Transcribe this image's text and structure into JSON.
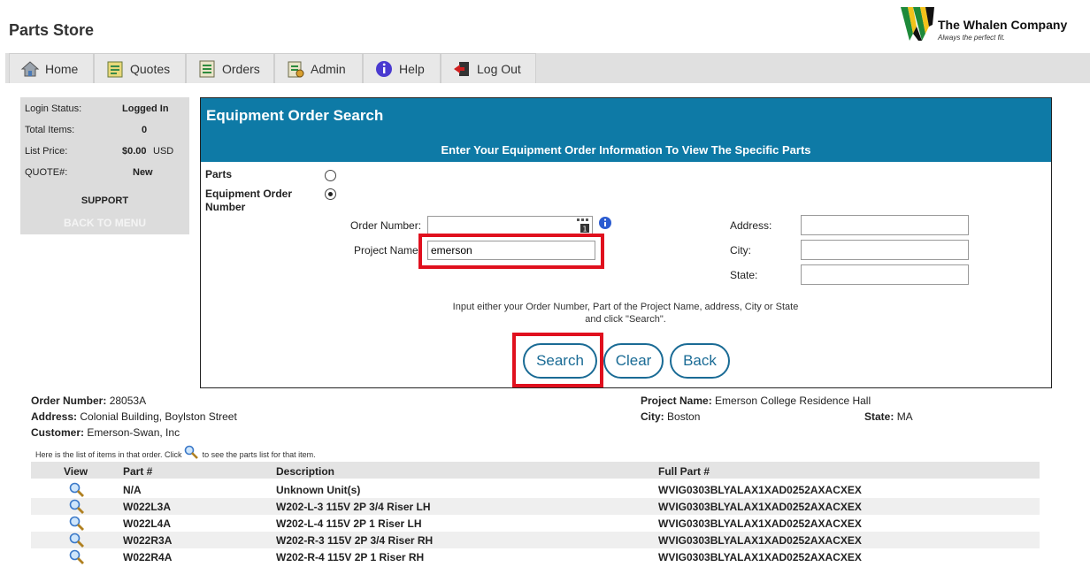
{
  "app": {
    "title": "Parts Store"
  },
  "logo": {
    "name": "The Whalen Company",
    "tagline": "Always the perfect fit."
  },
  "nav": [
    {
      "label": "Home",
      "icon": "home-icon"
    },
    {
      "label": "Quotes",
      "icon": "quotes-icon"
    },
    {
      "label": "Orders",
      "icon": "orders-icon"
    },
    {
      "label": "Admin",
      "icon": "admin-icon"
    },
    {
      "label": "Help",
      "icon": "help-icon"
    },
    {
      "label": "Log Out",
      "icon": "logout-icon"
    }
  ],
  "sidebar": {
    "login_status_label": "Login Status:",
    "login_status_value": "Logged In",
    "total_items_label": "Total Items:",
    "total_items_value": "0",
    "list_price_label": "List Price:",
    "list_price_value": "$0.00",
    "list_price_currency": "USD",
    "quote_label": "QUOTE#:",
    "quote_value": "New",
    "support": "SUPPORT",
    "back_to_menu": "BACK TO MENU"
  },
  "search": {
    "title": "Equipment Order Search",
    "subtitle": "Enter Your Equipment Order Information To View The Specific Parts",
    "option_parts": "Parts",
    "option_equipment": "Equipment Order Number",
    "selected_option": "equipment",
    "order_number_label": "Order Number:",
    "order_number_value": "",
    "project_name_label": "Project Name",
    "project_name_value": "emerson",
    "address_label": "Address:",
    "address_value": "",
    "city_label": "City:",
    "city_value": "",
    "state_label": "State:",
    "state_value": "",
    "hint_line1": "Input either your Order Number, Part of the Project Name, address, City or State",
    "hint_line2": "and click \"Search\".",
    "search_button": "Search",
    "clear_button": "Clear",
    "back_button": "Back",
    "highlight_color": "#e0101e",
    "header_color": "#0e7aa6"
  },
  "order": {
    "order_number_label": "Order Number:",
    "order_number": "28053A",
    "address_label": "Address:",
    "address": "Colonial Building, Boylston Street",
    "customer_label": "Customer:",
    "customer": "Emerson-Swan, Inc",
    "project_name_label": "Project Name:",
    "project_name": "Emerson College Residence Hall",
    "city_label": "City:",
    "city": "Boston",
    "state_label": "State:",
    "state": "MA",
    "note_before": "Here is the list of items in that order. Click",
    "note_after": "to see the parts list for that item."
  },
  "table": {
    "headers": [
      "View",
      "Part #",
      "Description",
      "Full Part #"
    ],
    "rows": [
      {
        "part": "N/A",
        "description": "Unknown Unit(s)",
        "full_part": "WVIG0303BLYALAX1XAD0252AXACXEX"
      },
      {
        "part": "W022L3A",
        "description": "W202-L-3 115V 2P 3/4 Riser LH",
        "full_part": "WVIG0303BLYALAX1XAD0252AXACXEX"
      },
      {
        "part": "W022L4A",
        "description": "W202-L-4 115V 2P 1 Riser LH",
        "full_part": "WVIG0303BLYALAX1XAD0252AXACXEX"
      },
      {
        "part": "W022R3A",
        "description": "W202-R-3 115V 2P 3/4 Riser RH",
        "full_part": "WVIG0303BLYALAX1XAD0252AXACXEX"
      },
      {
        "part": "W022R4A",
        "description": "W202-R-4 115V 2P 1 Riser RH",
        "full_part": "WVIG0303BLYALAX1XAD0252AXACXEX"
      }
    ]
  }
}
